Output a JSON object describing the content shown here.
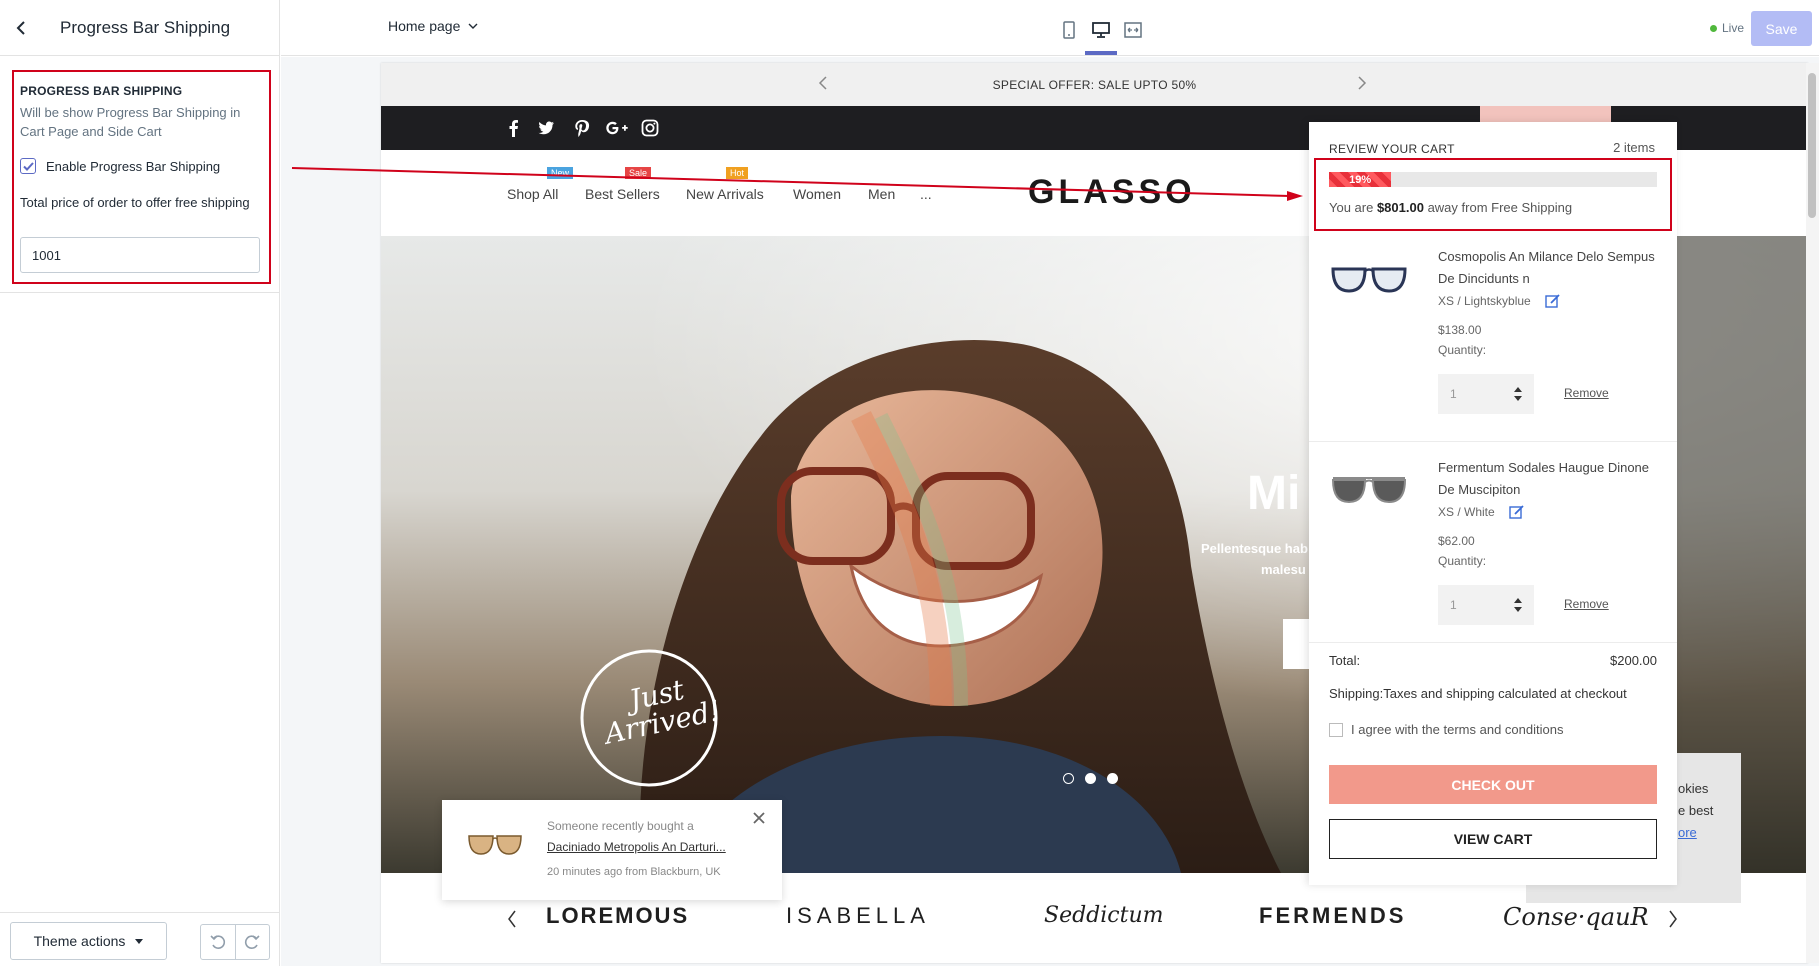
{
  "sidebar": {
    "title": "Progress Bar Shipping",
    "section_title": "PROGRESS BAR SHIPPING",
    "description": "Will be show Progress Bar Shipping in Cart Page and Side Cart",
    "enable_label": "Enable Progress Bar Shipping",
    "enable_checked": true,
    "price_label": "Total price of order to offer free shipping",
    "price_value": "1001",
    "theme_actions_label": "Theme actions"
  },
  "topbar": {
    "page_select": "Home page",
    "live_label": "Live",
    "save_label": "Save",
    "active_viewport": "desktop"
  },
  "store": {
    "announcement": "SPECIAL OFFER: SALE UPTO 50%",
    "logo": "GLASSO",
    "nav": [
      {
        "label": "Shop All",
        "badge": "New",
        "badge_color": "#4aa3df"
      },
      {
        "label": "Best Sellers",
        "badge": "Sale",
        "badge_color": "#e64545"
      },
      {
        "label": "New Arrivals",
        "badge": "Hot",
        "badge_color": "#f0a020"
      },
      {
        "label": "Women",
        "badge": "",
        "badge_color": ""
      },
      {
        "label": "Men",
        "badge": "",
        "badge_color": ""
      },
      {
        "label": "...",
        "badge": "",
        "badge_color": ""
      }
    ],
    "hero_partial_title": "Mi",
    "hero_partial_sub1": "Pellentesque hab",
    "hero_partial_sub2": "malesu",
    "hero_stamp_line1": "Just",
    "hero_stamp_line2": "Arrived!",
    "brands": [
      "LOREMOUS",
      "ISABELLA",
      "Seddictum",
      "FERMENDS",
      "Conse·qauR"
    ],
    "sold_popup": {
      "line1": "Someone recently bought a",
      "product": "Daciniado Metropolis An Darturi...",
      "time": "20 minutes ago from Blackburn, UK"
    },
    "cookie_partial": [
      "okies",
      "e best",
      "ore"
    ]
  },
  "cart": {
    "title": "REVIEW YOUR CART",
    "count": "2 items",
    "progress_percent": 19,
    "progress_label": "19%",
    "away_prefix": "You are ",
    "away_amount": "$801.00",
    "away_suffix": " away from Free Shipping",
    "items": [
      {
        "name": "Cosmopolis An Milance Delo Sempus De Dincidunts n",
        "variant": "XS / Lightskyblue",
        "price": "$138.00",
        "quantity_label": "Quantity:",
        "quantity": "1",
        "remove": "Remove"
      },
      {
        "name": "Fermentum Sodales Haugue Dinone De Muscipiton",
        "variant": "XS / White",
        "price": "$62.00",
        "quantity_label": "Quantity:",
        "quantity": "1",
        "remove": "Remove"
      }
    ],
    "total_label": "Total:",
    "total_value": "$200.00",
    "shipping_label": "Shipping:",
    "shipping_text": "Taxes and shipping calculated at checkout",
    "terms": "I agree with the terms and conditions",
    "checkout": "CHECK OUT",
    "view_cart": "VIEW CART"
  },
  "colors": {
    "accent": "#5c6ac4",
    "annotation_red": "#d0021b",
    "checkout_bg": "#f2998b",
    "progress_red": "#e8303a"
  }
}
